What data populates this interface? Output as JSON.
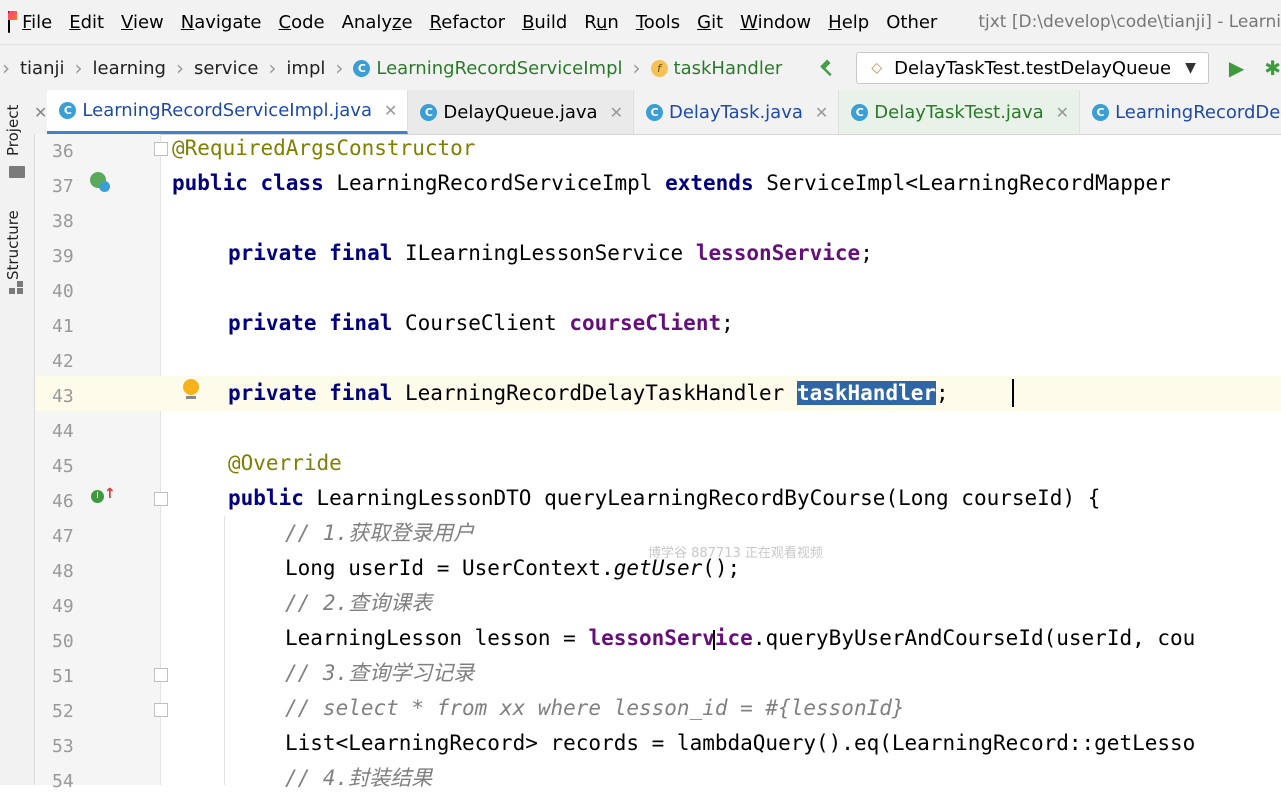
{
  "menu": {
    "items": [
      "File",
      "Edit",
      "View",
      "Navigate",
      "Code",
      "Analyze",
      "Refactor",
      "Build",
      "Run",
      "Tools",
      "Git",
      "Window",
      "Help",
      "Other"
    ],
    "underline": [
      "F",
      "E",
      "V",
      "N",
      "C",
      "z",
      "R",
      "B",
      "u",
      "T",
      "G",
      "W",
      "H",
      ""
    ],
    "title": "tjxt [D:\\develop\\code\\tianji] - Learni"
  },
  "breadcrumb": {
    "items": [
      "tianji",
      "learning",
      "service",
      "impl",
      "LearningRecordServiceImpl",
      "taskHandler"
    ]
  },
  "run_config": {
    "label": "DelayTaskTest.testDelayQueue"
  },
  "side_tools": {
    "project": "Project",
    "structure": "Structure"
  },
  "tabs": [
    {
      "label": "LearningRecordServiceImpl.java",
      "active": true
    },
    {
      "label": "DelayQueue.java"
    },
    {
      "label": "DelayTask.java"
    },
    {
      "label": "DelayTaskTest.java"
    },
    {
      "label": "LearningRecordDelayTa"
    }
  ],
  "editor": {
    "line_numbers": [
      "36",
      "37",
      "38",
      "39",
      "40",
      "41",
      "42",
      "43",
      "44",
      "45",
      "46",
      "47",
      "48",
      "49",
      "50",
      "51",
      "52",
      "53",
      "54"
    ],
    "lines": {
      "l36": {
        "ann": "@RequiredArgsConstructor"
      },
      "l37": {
        "kw1": "public class",
        "t1": " LearningRecordServiceImpl ",
        "kw2": "extends",
        "t2": " ServiceImpl<LearningRecordMapper"
      },
      "l39": {
        "kw": "private final",
        "type": " ILearningLessonService ",
        "field": "lessonService",
        "end": ";"
      },
      "l41": {
        "kw": "private final",
        "type": " CourseClient ",
        "field": "courseClient",
        "end": ";"
      },
      "l43": {
        "kw": "private final",
        "type": " LearningRecordDelayTaskHandler ",
        "field": "taskHandler",
        "end": ";"
      },
      "l45": {
        "ann": "@Override"
      },
      "l46": {
        "kw": "public",
        "rest": " LearningLessonDTO queryLearningRecordByCourse(Long courseId) {"
      },
      "l47": {
        "cmt": "// 1.获取登录用户"
      },
      "l48": {
        "t1": "Long userId = UserContext.",
        "it": "getUser",
        "t2": "();"
      },
      "l49": {
        "cmt": "// 2.查询课表"
      },
      "l50": {
        "t1": "LearningLesson lesson = ",
        "field": "lessonService",
        "t2": ".queryByUserAndCourseId(userId, cou"
      },
      "l51": {
        "cmt": "// 3.查询学习记录"
      },
      "l52": {
        "cmt": "// select * from xx where lesson_id = #{lessonId}"
      },
      "l53": {
        "t1": "List<LearningRecord> records = lambdaQuery().eq(LearningRecord::getLesso"
      },
      "l54": {
        "cmt": "// 4.封装结果"
      }
    }
  },
  "watermark": "博学谷 887713 正在观看视频",
  "colors": {
    "keyword": "#000080",
    "field": "#660e7a",
    "annotation": "#808000",
    "comment": "#808080",
    "selection": "#2f66a6"
  }
}
